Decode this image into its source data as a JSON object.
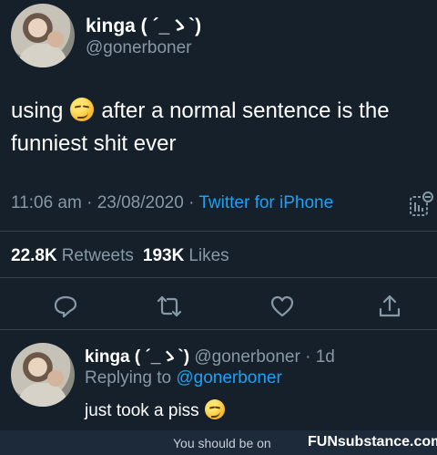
{
  "tweet": {
    "display_name": "kinga ( ´_ゝ`)",
    "handle": "@gonerboner",
    "text_part1": "using",
    "emoji": "smirking-face",
    "text_part2": "after a normal sentence is the funniest shit ever",
    "time": "11:06 am",
    "date": "23/08/2020",
    "source": "Twitter for iPhone",
    "retweets_count": "22.8K",
    "retweets_label": "Retweets",
    "likes_count": "193K",
    "likes_label": "Likes"
  },
  "actions": [
    "reply-icon",
    "retweet-icon",
    "like-icon",
    "share-icon"
  ],
  "reply": {
    "display_name": "kinga ( ´_ゝ`)",
    "handle": "@gonerboner",
    "age": "1d",
    "replying_prefix": "Replying to",
    "replying_to": "@gonerboner",
    "text": "just took a piss",
    "emoji": "smirking-face"
  },
  "footer": {
    "text": "You should be on",
    "brand": "FUNsubstance.com"
  },
  "colors": {
    "background": "#15202b",
    "accent": "#1da1f2",
    "muted": "#8899a6"
  }
}
